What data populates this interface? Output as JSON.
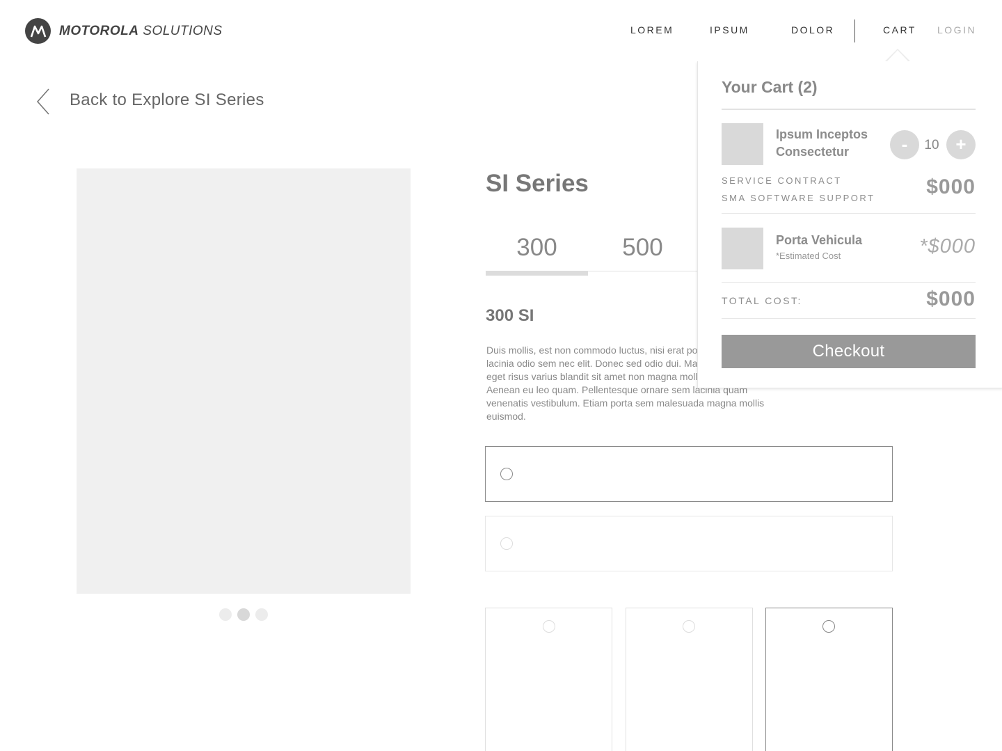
{
  "header": {
    "brand_bold": "MOTOROLA",
    "brand_light": "SOLUTIONS",
    "nav": [
      {
        "label": "LOREM"
      },
      {
        "label": "IPSUM"
      },
      {
        "label": "DOLOR"
      },
      {
        "label": "CART"
      },
      {
        "label": "LOGIN"
      }
    ]
  },
  "back_link": {
    "label": "Back to Explore SI Series",
    "icon": "chevron-left-icon"
  },
  "gallery": {
    "dots": 3,
    "active_dot": 2
  },
  "product": {
    "series_title": "SI Series",
    "tabs": [
      {
        "label": "300"
      },
      {
        "label": "500"
      }
    ],
    "active_tab": "300",
    "model_name": "300 SI",
    "description": "Duis mollis, est non commodo luctus, nisi erat porttitor ligula, eget lacinia odio sem nec elit. Donec sed odio dui. Maecenas sed diam eget risus varius blandit sit amet non magna mollis interdum. Aenean eu leo quam. Pellentesque ornare sem lacinia quam venenatis vestibulum. Etiam porta sem malesuada magna mollis euismod."
  },
  "cart": {
    "title": "Your Cart (2)",
    "items": [
      {
        "name_line1": "Ipsum Inceptos",
        "name_line2": "Consectetur",
        "quantity": "10",
        "minus_label": "-",
        "plus_label": "+",
        "service_contract_label": "SERVICE CONTRACT",
        "software_support_label": "SMA SOFTWARE SUPPORT",
        "price": "$000"
      },
      {
        "name": "Porta Vehicula",
        "note": "*Estimated Cost",
        "price": "*$000"
      }
    ],
    "total_label": "TOTAL COST:",
    "total_price": "$000",
    "checkout_label": "Checkout"
  }
}
